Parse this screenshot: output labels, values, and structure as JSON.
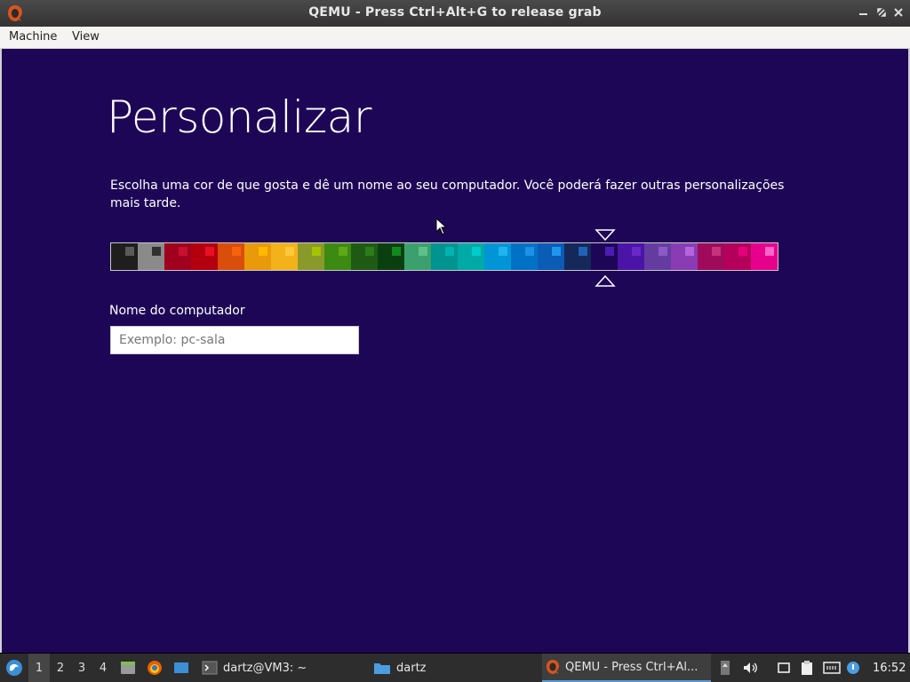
{
  "window": {
    "title": "QEMU - Press Ctrl+Alt+G to release grab"
  },
  "menubar": {
    "machine": "Machine",
    "view": "View"
  },
  "guest": {
    "title": "Personalizar",
    "description": "Escolha uma cor de que gosta e dê um nome ao seu computador. Você poderá fazer outras personalizações mais tarde.",
    "selected_color_index": 18,
    "colors": [
      {
        "bg": "#1e1e1e",
        "accent": "#5a5a5a"
      },
      {
        "bg": "#8a8a8a",
        "accent": "#303030"
      },
      {
        "bg": "#a0001e",
        "accent": "#c8102e"
      },
      {
        "bg": "#b4000e",
        "accent": "#e81123"
      },
      {
        "bg": "#d94e0a",
        "accent": "#f7630c"
      },
      {
        "bg": "#e89a0a",
        "accent": "#ffb900"
      },
      {
        "bg": "#f4b21a",
        "accent": "#ffc83d"
      },
      {
        "bg": "#8a9a2a",
        "accent": "#a4c400"
      },
      {
        "bg": "#3c8a12",
        "accent": "#60a917"
      },
      {
        "bg": "#1e5a14",
        "accent": "#2d7d1a"
      },
      {
        "bg": "#0a4010",
        "accent": "#128a1e"
      },
      {
        "bg": "#3ca06e",
        "accent": "#60c08a"
      },
      {
        "bg": "#009490",
        "accent": "#00b4b0"
      },
      {
        "bg": "#00aaa6",
        "accent": "#00cccc"
      },
      {
        "bg": "#0096d6",
        "accent": "#1eb4f0"
      },
      {
        "bg": "#0072c6",
        "accent": "#1e90e6"
      },
      {
        "bg": "#0a5cb4",
        "accent": "#1e96f0"
      },
      {
        "bg": "#14285a",
        "accent": "#1e64b4"
      },
      {
        "bg": "#1e0656",
        "accent": "#4a1eb4"
      },
      {
        "bg": "#4a14a6",
        "accent": "#6a28c8"
      },
      {
        "bg": "#643ca0",
        "accent": "#8c5ac8"
      },
      {
        "bg": "#8a3cb4",
        "accent": "#b464dc"
      },
      {
        "bg": "#a00a5a",
        "accent": "#c8327a"
      },
      {
        "bg": "#b4005a",
        "accent": "#e6007a"
      },
      {
        "bg": "#e6008c",
        "accent": "#ff64c8"
      }
    ],
    "computer_name_label": "Nome do computador",
    "computer_name_placeholder": "Exemplo: pc-sala",
    "computer_name_value": ""
  },
  "taskbar": {
    "workspaces": [
      "1",
      "2",
      "3",
      "4"
    ],
    "active_workspace": "1",
    "launchers": [
      "file-manager-icon",
      "firefox-icon",
      "desktop-icon"
    ],
    "tasks": [
      {
        "label": "dartz@VM3: ~",
        "icon": "terminal-icon"
      },
      {
        "label": "dartz",
        "icon": "folder-icon"
      },
      {
        "label": "QEMU - Press Ctrl+Al...",
        "icon": "qemu-icon",
        "active": true
      }
    ],
    "tray": [
      "scroll-icon",
      "volume-icon",
      "display-icon",
      "clipboard-icon",
      "network-icon",
      "notification-icon"
    ],
    "clock": "16:52"
  }
}
